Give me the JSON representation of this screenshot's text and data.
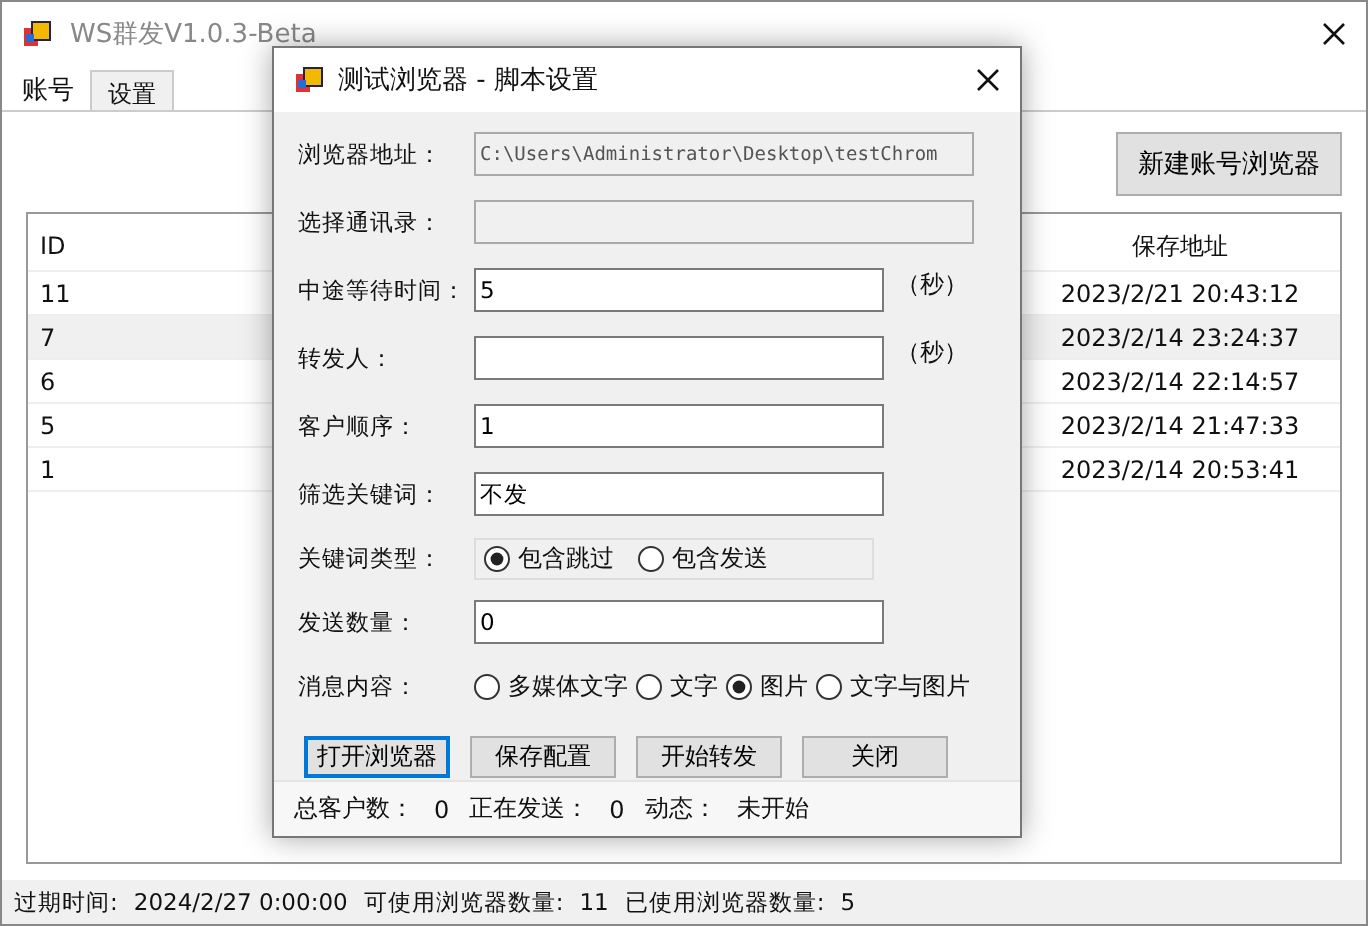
{
  "window": {
    "title": "WS群发V1.0.3-Beta"
  },
  "tabs": [
    {
      "label": "账号",
      "selected": true
    },
    {
      "label": "设置",
      "selected": false
    }
  ],
  "new_button": "新建账号浏览器",
  "table": {
    "columns": [
      "ID",
      "保存地址"
    ],
    "rows": [
      {
        "id": "11",
        "saved": "2023/2/21 20:43:12",
        "selected": false
      },
      {
        "id": "7",
        "saved": "2023/2/14 23:24:37",
        "selected": true
      },
      {
        "id": "6",
        "saved": "2023/2/14 22:14:57",
        "selected": false
      },
      {
        "id": "5",
        "saved": "2023/2/14 21:47:33",
        "selected": false
      },
      {
        "id": "1",
        "saved": "2023/2/14 20:53:41",
        "selected": false
      }
    ]
  },
  "status_bar": [
    {
      "label": "过期时间:",
      "value": "2024/2/27 0:00:00"
    },
    {
      "label": "可使用浏览器数量:",
      "value": "11"
    },
    {
      "label": "已使用浏览器数量:",
      "value": "5"
    }
  ],
  "dialog": {
    "title": "测试浏览器 - 脚本设置",
    "rows": [
      {
        "kind": "field",
        "label": "浏览器地址：",
        "value": "C:\\Users\\Administrator\\Desktop\\testChrom",
        "disabled": true
      },
      {
        "kind": "field",
        "label": "选择通讯录：",
        "disabled": true
      },
      {
        "kind": "field",
        "label": "中途等待时间：",
        "value": "5",
        "suffix": "（秒）",
        "disabled": false
      },
      {
        "kind": "field",
        "label": "转发人：",
        "suffix": "（秒）",
        "disabled": false
      },
      {
        "kind": "field",
        "label": "客户顺序：",
        "value": "1",
        "disabled": false
      },
      {
        "kind": "field",
        "label": "筛选关键词：",
        "value": "不发",
        "disabled": false
      },
      {
        "kind": "radio",
        "label": "关键词类型：",
        "options": [
          {
            "label": "包含跳过",
            "selected": true
          },
          {
            "label": "包含发送",
            "selected": false
          }
        ]
      },
      {
        "kind": "field",
        "label": "发送数量：",
        "value": "0",
        "disabled": false
      },
      {
        "kind": "radio",
        "label": "消息内容：",
        "options": [
          {
            "label": "多媒体文字",
            "selected": false
          },
          {
            "label": "文字",
            "selected": false
          },
          {
            "label": "图片",
            "selected": true
          },
          {
            "label": "文字与图片",
            "selected": false
          }
        ]
      }
    ],
    "buttons": [
      {
        "label": "打开浏览器",
        "focused": true
      },
      {
        "label": "保存配置",
        "focused": false
      },
      {
        "label": "开始转发",
        "focused": false
      },
      {
        "label": "关闭",
        "focused": false
      }
    ],
    "status": [
      {
        "label": "总客户数：",
        "value": "0"
      },
      {
        "label": "正在发送：",
        "value": "0"
      },
      {
        "label": "动态：",
        "value": "未开始"
      }
    ]
  }
}
